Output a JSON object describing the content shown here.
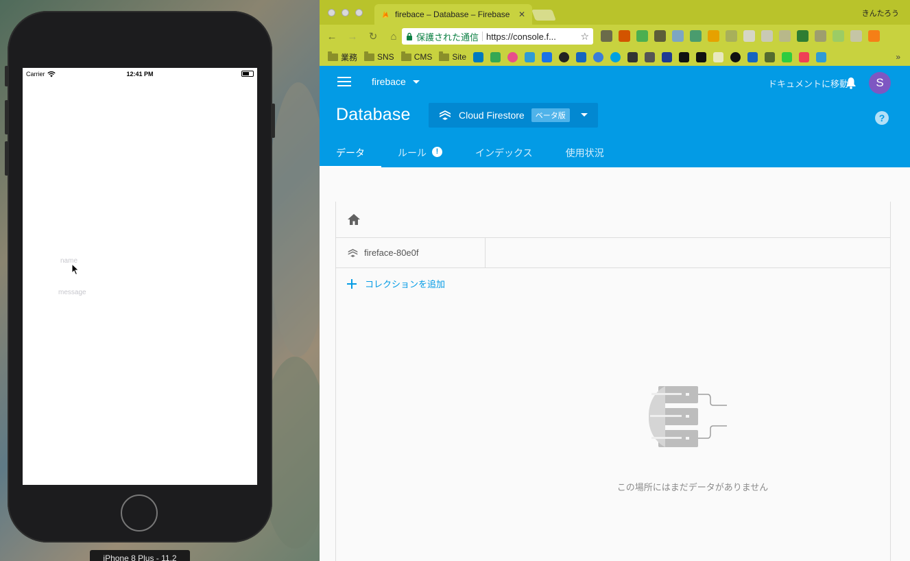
{
  "simulator": {
    "statusbar": {
      "carrier": "Carrier",
      "time": "12:41 PM"
    },
    "fields": {
      "name_placeholder": "name",
      "message_placeholder": "message"
    },
    "device_label": "iPhone 8 Plus - 11.2"
  },
  "browser": {
    "tab_title": "firebace – Database – Firebase",
    "profile_name": "きんたろう",
    "secure_label": "保護された通信",
    "url": "https://console.f...",
    "bookmarks": [
      "業務",
      "SNS",
      "CMS",
      "Site"
    ]
  },
  "firebase": {
    "project_name": "firebace",
    "docs_link": "ドキュメントに移動",
    "avatar_initial": "S",
    "page_title": "Database",
    "db_type": "Cloud Firestore",
    "beta_badge": "ベータ版",
    "help": "?",
    "tabs": [
      "データ",
      "ルール",
      "インデックス",
      "使用状況"
    ],
    "rules_warning": "!",
    "root_name": "fireface-80e0f",
    "add_collection": "コレクションを追加",
    "empty_message": "この場所にはまだデータがありません"
  },
  "colors": {
    "firebase_blue": "#039be5",
    "chrome_theme": "#c8d23f",
    "avatar": "#7e57c2"
  }
}
